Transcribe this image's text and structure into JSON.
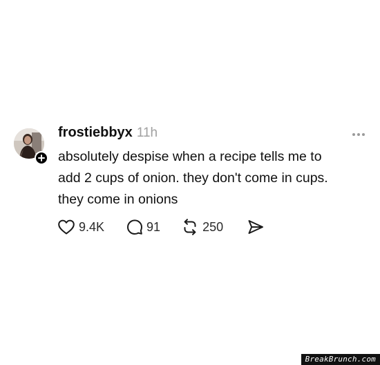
{
  "post": {
    "username": "frostiebbyx",
    "timestamp": "11h",
    "text_lines": [
      "absolutely despise when a recipe tells me to",
      "add 2 cups of onion. they don't come in cups.",
      "they come in onions"
    ],
    "avatar_icon": "profile-photo",
    "follow_icon": "plus-icon",
    "more_icon": "ellipsis-icon"
  },
  "actions": {
    "like": {
      "icon": "heart-icon",
      "count": "9.4K"
    },
    "reply": {
      "icon": "comment-icon",
      "count": "91"
    },
    "repost": {
      "icon": "repost-icon",
      "count": "250"
    },
    "share": {
      "icon": "send-icon"
    }
  },
  "watermark": {
    "text": "BreakBrunch.com"
  },
  "colors": {
    "text": "#101010",
    "muted": "#a0a0a0",
    "badge": "#000000",
    "background": "#ffffff"
  }
}
